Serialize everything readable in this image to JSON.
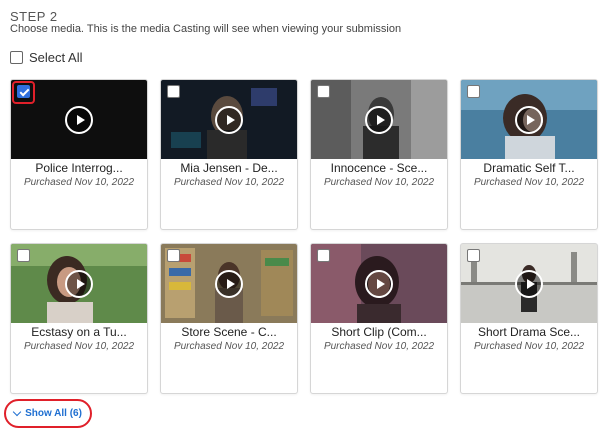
{
  "step": {
    "title": "STEP 2",
    "description": "Choose media. This is the media Casting will see when viewing your submission"
  },
  "select_all": {
    "label": "Select All",
    "checked": false
  },
  "media": [
    {
      "title": "Police Interrog...",
      "date": "Purchased Nov 10, 2022",
      "checked": true,
      "highlighted": true
    },
    {
      "title": "Mia Jensen - De...",
      "date": "Purchased Nov 10, 2022",
      "checked": false
    },
    {
      "title": "Innocence - Sce...",
      "date": "Purchased Nov 10, 2022",
      "checked": false
    },
    {
      "title": "Dramatic Self T...",
      "date": "Purchased Nov 10, 2022",
      "checked": false
    },
    {
      "title": "Ecstasy on a Tu...",
      "date": "Purchased Nov 10, 2022",
      "checked": false
    },
    {
      "title": "Store Scene - C...",
      "date": "Purchased Nov 10, 2022",
      "checked": false
    },
    {
      "title": "Short Clip (Com...",
      "date": "Purchased Nov 10, 2022",
      "checked": false
    },
    {
      "title": "Short Drama Sce...",
      "date": "Purchased Nov 10, 2022",
      "checked": false
    }
  ],
  "show_all": {
    "label": "Show All (6)",
    "icon": "chevron-down-icon"
  },
  "colors": {
    "accent": "#1f6fd1",
    "checkbox_checked": "#2f6fde",
    "highlight": "#e0202a"
  }
}
